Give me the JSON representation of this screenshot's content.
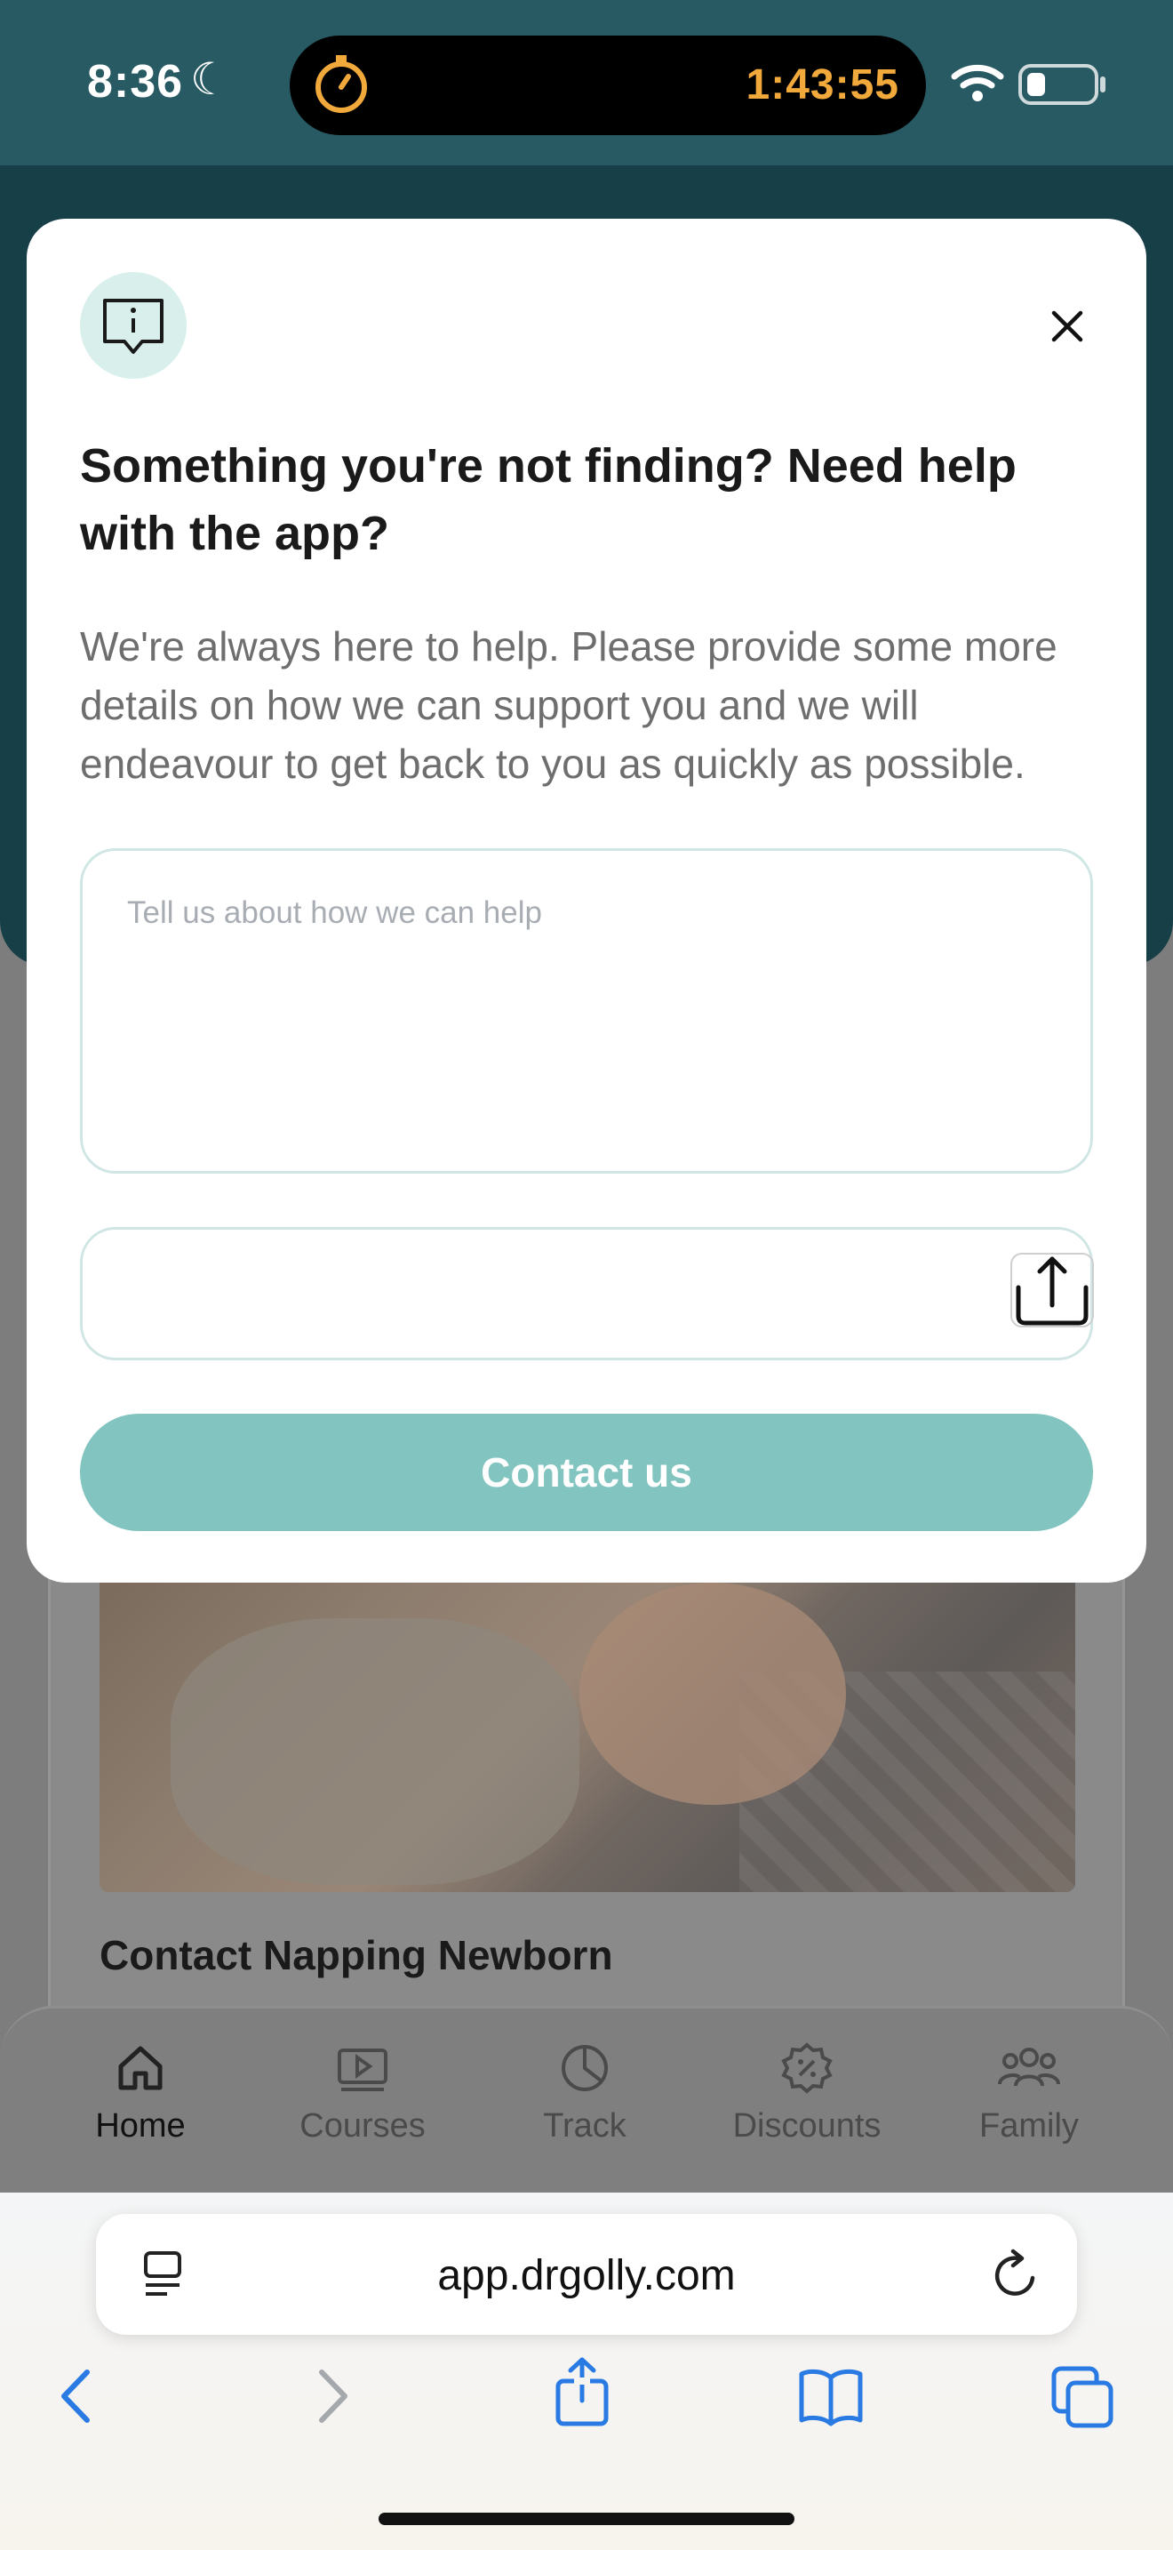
{
  "status_bar": {
    "time": "8:36",
    "timer": "1:43:55"
  },
  "modal": {
    "title": "Something you're not finding? Need help with the app?",
    "description": "We're always here to help. Please provide some more details on how we can support you and we will endeavour to get back to you as quickly as possible.",
    "textarea_placeholder": "Tell us about how we can help",
    "submit_label": "Contact us"
  },
  "background": {
    "card_title": "Contact Napping Newborn"
  },
  "tab_bar": {
    "tabs": [
      {
        "label": "Home",
        "icon": "home-icon",
        "active": true
      },
      {
        "label": "Courses",
        "icon": "play-icon",
        "active": false
      },
      {
        "label": "Track",
        "icon": "pie-chart-icon",
        "active": false
      },
      {
        "label": "Discounts",
        "icon": "discount-icon",
        "active": false
      },
      {
        "label": "Family",
        "icon": "family-icon",
        "active": false
      }
    ]
  },
  "browser": {
    "url": "app.drgolly.com"
  },
  "colors": {
    "brand_teal": "#82c4bf",
    "header_dark": "#285a63",
    "timer_orange": "#f2a93b",
    "ios_blue": "#2a7ae4"
  }
}
